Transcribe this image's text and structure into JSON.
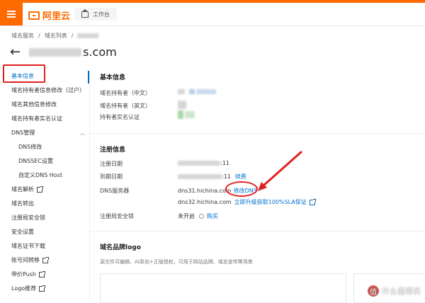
{
  "colors": {
    "brand": "#ff6a00",
    "link": "#0070cc",
    "annotation": "#e02020"
  },
  "topbar": {
    "logo_text": "阿里云",
    "workbench_label": "工作台"
  },
  "breadcrumb": {
    "item1": "域名服务",
    "sep": "/",
    "item2": "域名列表"
  },
  "title": {
    "domain_visible": "s.com"
  },
  "sidebar": {
    "items": [
      {
        "label": "基本信息",
        "active": true
      },
      {
        "label": "域名持有者信息修改（过户）"
      },
      {
        "label": "域名其他信息修改"
      },
      {
        "label": "域名持有者实名认证"
      },
      {
        "label": "DNS管理",
        "expanded": true
      },
      {
        "label": "DNS修改",
        "sub": true
      },
      {
        "label": "DNSSEC设置",
        "sub": true
      },
      {
        "label": "自定义DNS Host",
        "sub": true
      },
      {
        "label": "域名解析",
        "external": true
      },
      {
        "label": "域名转出"
      },
      {
        "label": "注册局安全锁"
      },
      {
        "label": "安全设置"
      },
      {
        "label": "域名证书下载"
      },
      {
        "label": "账号间转移",
        "external": true
      },
      {
        "label": "带价Push",
        "external": true
      },
      {
        "label": "Logo推荐",
        "external": true
      }
    ]
  },
  "basic": {
    "title": "基本信息",
    "holder_cn_label": "域名持有者（中文）",
    "holder_en_label": "域名持有者（英文）",
    "verify_label": "持有者实名认证"
  },
  "register": {
    "title": "注册信息",
    "reg_date_label": "注册日期",
    "reg_date_tail": ":11",
    "exp_date_label": "到期日期",
    "exp_date_tail": ":11",
    "renew_link": "续费",
    "dns_label": "DNS服务器",
    "dns1": "dns31.hichina.com",
    "modify_dns_link": "修改DNS",
    "dns2": "dns32.hichina.com",
    "upgrade_link": "立即升级获取100%SLA保证",
    "lock_label": "注册局安全锁",
    "lock_value": "未开启",
    "buy_link": "购买"
  },
  "brand": {
    "title": "域名品牌logo",
    "desc": "源文件可编辑、AI原创+正版授权，可用于网站品牌、域名宣传等场景"
  },
  "watermark": {
    "badge": "值",
    "text": "什么值得买"
  }
}
